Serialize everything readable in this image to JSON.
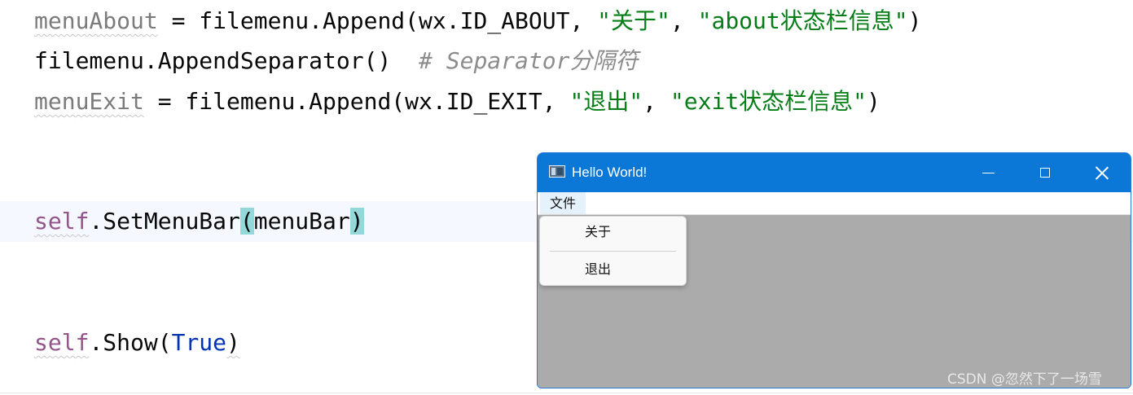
{
  "code": {
    "line1": {
      "var": "menuAbout",
      "op": " = ",
      "call": "filemenu.Append(wx.ID_ABOUT, ",
      "str1": "\"关于\"",
      "sep": ", ",
      "str2": "\"about状态栏信息\"",
      "close": ")"
    },
    "line2": {
      "call": "filemenu.AppendSeparator()",
      "comment": "# Separator分隔符"
    },
    "line3": {
      "var": "menuExit",
      "op": " = ",
      "call": "filemenu.Append(wx.ID_EXIT, ",
      "str1": "\"退出\"",
      "sep": ", ",
      "str2": "\"exit状态栏信息\"",
      "close": ")"
    },
    "line4": {
      "self": "self",
      "method": ".SetMenuBar",
      "open": "(",
      "arg": "menuBar",
      "close": ")"
    },
    "line5": {
      "self": "self",
      "method": ".Show(",
      "arg": "True",
      "close": ")"
    }
  },
  "window": {
    "title": "Hello World!",
    "menubar": {
      "file_label": "文件"
    },
    "dropdown": {
      "about_label": "关于",
      "exit_label": "退出"
    }
  },
  "watermark": "CSDN @忽然下了一场雪",
  "colors": {
    "titlebar": "#0b77d6",
    "client_area": "#ababab",
    "string": "#067d17",
    "comment": "#8c8c8c",
    "keyword": "#0033b3",
    "self": "#94558d",
    "paren_highlight": "#93d9d9"
  },
  "icons": {
    "app": "app-window-icon",
    "minimize": "minimize-icon",
    "maximize": "maximize-icon",
    "close": "close-icon"
  }
}
